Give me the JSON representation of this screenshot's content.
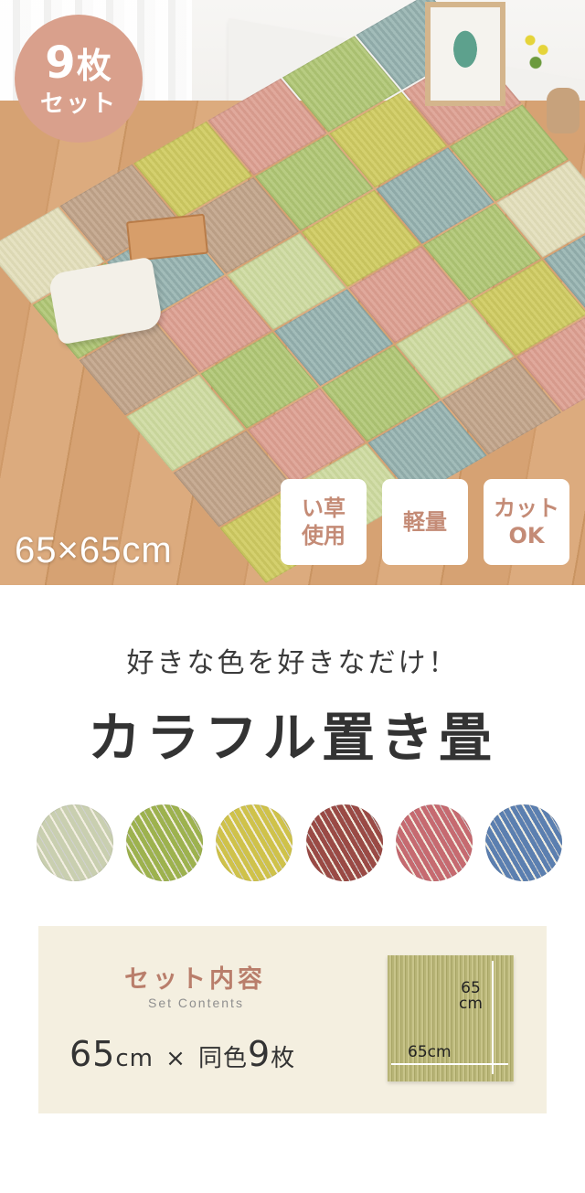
{
  "badge": {
    "count": "9",
    "unit": "枚",
    "label": "セット"
  },
  "hero": {
    "size_label": "65×65cm"
  },
  "features": [
    {
      "label": "い草\n使用"
    },
    {
      "label": "軽量"
    },
    {
      "label": "カット\nOK"
    }
  ],
  "tagline": "好きな色を好きなだけ！",
  "headline": "カラフル置き畳",
  "swatches": [
    {
      "icon": "swatch-natural",
      "color": "#c9cfb0"
    },
    {
      "icon": "swatch-green",
      "color": "#9db24e"
    },
    {
      "icon": "swatch-yellow",
      "color": "#cfc24a"
    },
    {
      "icon": "swatch-brown",
      "color": "#9a4a45"
    },
    {
      "icon": "swatch-pink",
      "color": "#c66a70"
    },
    {
      "icon": "swatch-blue",
      "color": "#5b7fb0"
    }
  ],
  "set_contents": {
    "title": "セット内容",
    "subtitle": "Set Contents",
    "size": "65",
    "size_unit": "cm",
    "times": "×",
    "same_color": "同色",
    "count": "9",
    "count_unit": "枚",
    "dim_vertical": "65\ncm",
    "dim_horizontal": "65cm"
  }
}
